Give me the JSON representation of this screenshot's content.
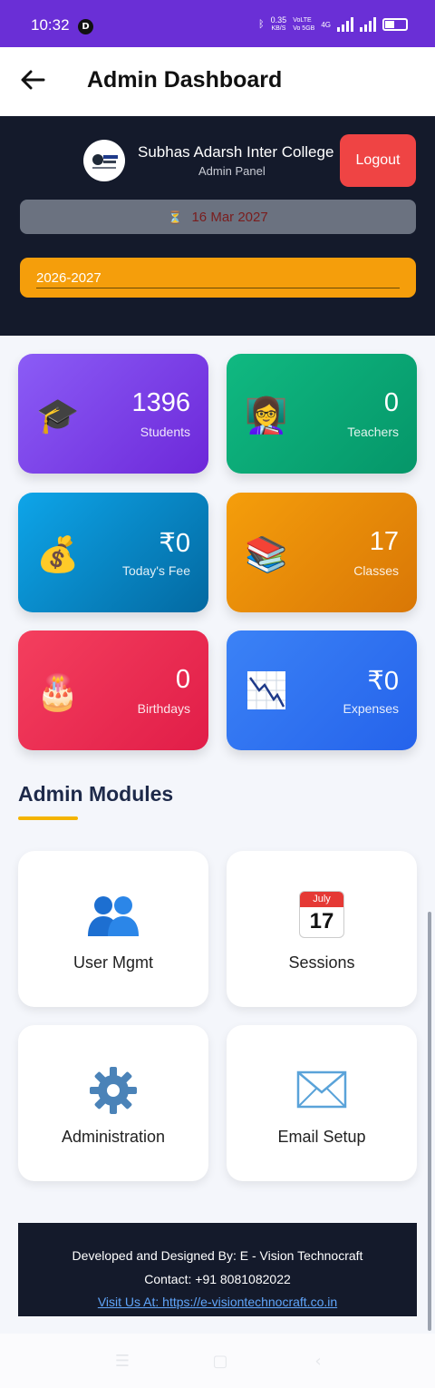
{
  "status_bar": {
    "time": "10:32",
    "notification_badge": "D",
    "net_speed_value": "0.35",
    "net_speed_unit": "KB/S",
    "volte_1": "VoLTE",
    "volte_2": "Vo 5GB",
    "network_type": "4G"
  },
  "app_bar": {
    "title": "Admin Dashboard"
  },
  "header": {
    "college_name": "Subhas Adarsh Inter College",
    "panel_label": "Admin Panel",
    "logout_label": "Logout",
    "date": "16 Mar 2027",
    "session": "2026-2027"
  },
  "stats": [
    {
      "value": "1396",
      "label": "Students",
      "icon": "graduation-cap-icon"
    },
    {
      "value": "0",
      "label": "Teachers",
      "icon": "teacher-icon"
    },
    {
      "value": "₹0",
      "label": "Today's Fee",
      "icon": "money-bag-icon"
    },
    {
      "value": "17",
      "label": "Classes",
      "icon": "books-icon"
    },
    {
      "value": "0",
      "label": "Birthdays",
      "icon": "birthday-cake-icon"
    },
    {
      "value": "₹0",
      "label": "Expenses",
      "icon": "chart-decreasing-icon"
    }
  ],
  "modules_title": "Admin Modules",
  "modules": [
    {
      "label": "User Mgmt",
      "icon": "users-icon"
    },
    {
      "label": "Sessions",
      "icon": "calendar-icon",
      "calendar_month": "July",
      "calendar_day": "17"
    },
    {
      "label": "Administration",
      "icon": "gear-icon"
    },
    {
      "label": "Email Setup",
      "icon": "envelope-icon"
    }
  ],
  "footer": {
    "line1": "Developed and Designed By: E - Vision Technocraft",
    "line2": "Contact: +91 8081082022",
    "line3": "Visit Us At: https://e-visiontechnocraft.co.in"
  },
  "colors": {
    "status_bar": "#6a2fd6",
    "header_bg": "#141a2b",
    "logout": "#ef4444",
    "session": "#f59e0b",
    "accent_underline": "#f4b400"
  }
}
